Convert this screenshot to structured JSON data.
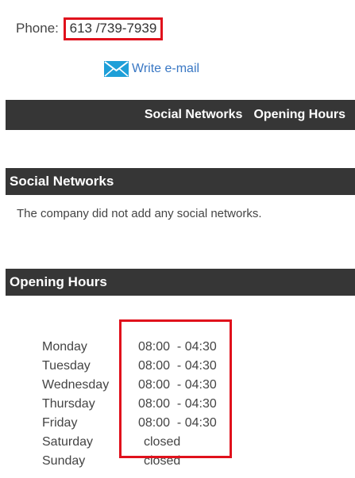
{
  "contact": {
    "phone_label": "Phone:",
    "phone_value": "613 /739-7939",
    "email_icon": "envelope-icon",
    "email_link": "Write e-mail"
  },
  "tabs": [
    {
      "label": "Social Networks"
    },
    {
      "label": "Opening Hours"
    }
  ],
  "social_networks": {
    "title": "Social Networks",
    "message": "The company did not add any social networks."
  },
  "opening_hours": {
    "title": "Opening Hours",
    "rows": [
      {
        "day": "Monday",
        "time": "08:00  - 04:30"
      },
      {
        "day": "Tuesday",
        "time": "08:00  - 04:30"
      },
      {
        "day": "Wednesday",
        "time": "08:00  - 04:30"
      },
      {
        "day": "Thursday",
        "time": "08:00  - 04:30"
      },
      {
        "day": "Friday",
        "time": "08:00  - 04:30"
      },
      {
        "day": "Saturday",
        "time": "closed"
      },
      {
        "day": "Sunday",
        "time": "closed"
      }
    ]
  },
  "colors": {
    "bar_background": "#363636",
    "highlight_border": "#e0111c",
    "link": "#3a78c4",
    "icon": "#1e9fd8"
  }
}
